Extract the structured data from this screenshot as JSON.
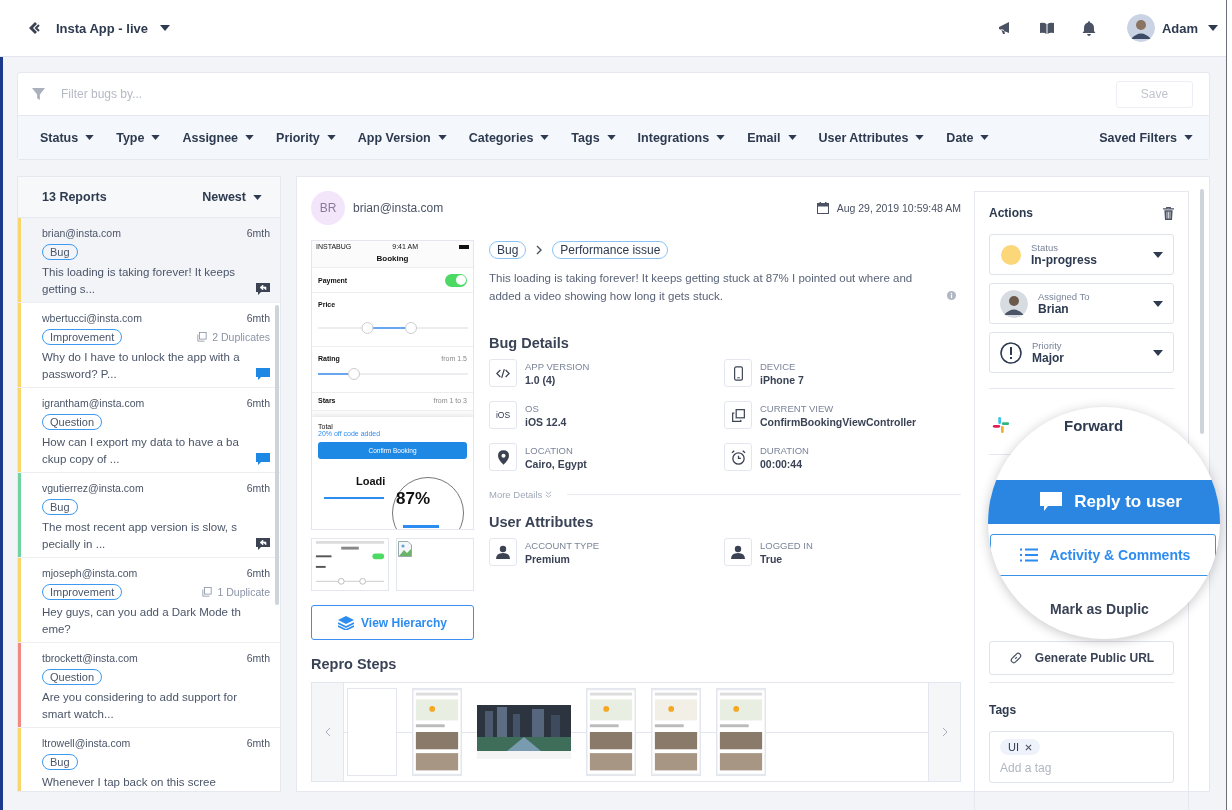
{
  "header": {
    "app_name": "Insta App - live",
    "user": "Adam"
  },
  "filter": {
    "placeholder": "Filter bugs by...",
    "save": "Save",
    "chips": [
      "Status",
      "Type",
      "Assignee",
      "Priority",
      "App Version",
      "Categories",
      "Tags",
      "Integrations",
      "Email",
      "User Attributes",
      "Date"
    ],
    "saved_filters": "Saved Filters"
  },
  "reports": {
    "count": "13 Reports",
    "sort": "Newest",
    "items": [
      {
        "email": "brian@insta.com",
        "time": "6mth",
        "category": "Bug",
        "text": "This loading is taking forever! It keeps getting s...",
        "selected": true,
        "color": "#f9d56e",
        "kind": "replied"
      },
      {
        "email": "wbertucci@insta.com",
        "time": "6mth",
        "category": "Improvement",
        "duplicates": "2 Duplicates",
        "text": "Why do I have to unlock the app with a password? P...",
        "selected": false,
        "color": "#f9d56e",
        "kind": "message"
      },
      {
        "email": "igrantham@insta.com",
        "time": "6mth",
        "category": "Question",
        "text": "How can I export my data to have a backup copy of ...",
        "selected": false,
        "color": "#f9d56e",
        "kind": "message"
      },
      {
        "email": "vgutierrez@insta.com",
        "time": "6mth",
        "category": "Bug",
        "text": "The most recent app version is slow, specially in ...",
        "selected": false,
        "color": "#6fd3a0",
        "kind": "replied"
      },
      {
        "email": "mjoseph@insta.com",
        "time": "6mth",
        "category": "Improvement",
        "duplicates": "1 Duplicate",
        "text": "Hey guys, can you add a Dark Mode theme?",
        "selected": false,
        "color": "#f9d56e",
        "kind": "plain"
      },
      {
        "email": "tbrockett@insta.com",
        "time": "6mth",
        "category": "Question",
        "text": "Are you considering to add support for smart watch...",
        "selected": false,
        "color": "#f08a80",
        "kind": "plain"
      },
      {
        "email": "ltrowell@insta.com",
        "time": "6mth",
        "category": "Bug",
        "text": "Whenever I tap back on this scree",
        "selected": false,
        "color": "#f9d56e",
        "kind": "plain"
      }
    ]
  },
  "report": {
    "initials": "BR",
    "email": "brian@insta.com",
    "date": "Aug 29, 2019 10:59:48 AM",
    "category": "Bug",
    "subcategory": "Performance issue",
    "description": "This loading is taking forever! It keeps getting stuck at 87% I pointed out where and added a video showing how long it gets stuck.",
    "screenshot": {
      "carrier": "INSTABUG",
      "time": "9:41 AM",
      "title": "Booking",
      "payment": "Payment",
      "payment_on": true,
      "price": "Price",
      "price_slider": [
        {
          "level": 0.33
        },
        {
          "level": 0.62
        }
      ],
      "rating": "Rating",
      "rating_slider": {
        "level": 0.24
      },
      "rating_hint": "from 1.5",
      "stars": "Stars",
      "stars_hint": "from 1 to 3",
      "total": "Total",
      "discount": "20% off code added",
      "confirm": "Confirm Booking",
      "loading": "Loadi",
      "percent": "87%"
    },
    "view_hierarchy": "View Hierarchy",
    "bug_details_title": "Bug Details",
    "bug_details": [
      {
        "label": "APP VERSION",
        "value": "1.0 (4)",
        "kind": "code"
      },
      {
        "label": "DEVICE",
        "value": "iPhone 7",
        "kind": "device"
      },
      {
        "label": "OS",
        "value": "iOS 12.4",
        "kind": "os",
        "icon_text": "iOS"
      },
      {
        "label": "CURRENT VIEW",
        "value": "ConfirmBookingViewController",
        "kind": "view"
      },
      {
        "label": "LOCATION",
        "value": "Cairo, Egypt",
        "kind": "location"
      },
      {
        "label": "DURATION",
        "value": "00:00:44",
        "kind": "duration"
      }
    ],
    "more_details": "More Details",
    "user_attributes_title": "User Attributes",
    "user_attributes": [
      {
        "label": "ACCOUNT TYPE",
        "value": "Premium"
      },
      {
        "label": "LOGGED IN",
        "value": "True"
      }
    ],
    "repro_title": "Repro Steps",
    "repro_steps": [
      {
        "kind": "blank"
      },
      {
        "kind": "screen"
      },
      {
        "kind": "wide"
      },
      {
        "kind": "screen"
      },
      {
        "kind": "screen"
      },
      {
        "kind": "screen"
      }
    ]
  },
  "actions": {
    "title": "Actions",
    "dropdowns": [
      {
        "label": "Status",
        "value": "In-progress",
        "kind": "status",
        "color": "#fcd77a"
      },
      {
        "label": "Assigned To",
        "value": "Brian",
        "kind": "person"
      },
      {
        "label": "Priority",
        "value": "Major",
        "kind": "priority"
      }
    ],
    "forward": "Forward",
    "reply": "Reply to user",
    "activity": "Activity & Comments",
    "duplicate": "Mark as Duplic",
    "public_url": "Generate Public URL"
  },
  "tags": {
    "title": "Tags",
    "items": [
      "UI"
    ],
    "placeholder": "Add a tag"
  }
}
